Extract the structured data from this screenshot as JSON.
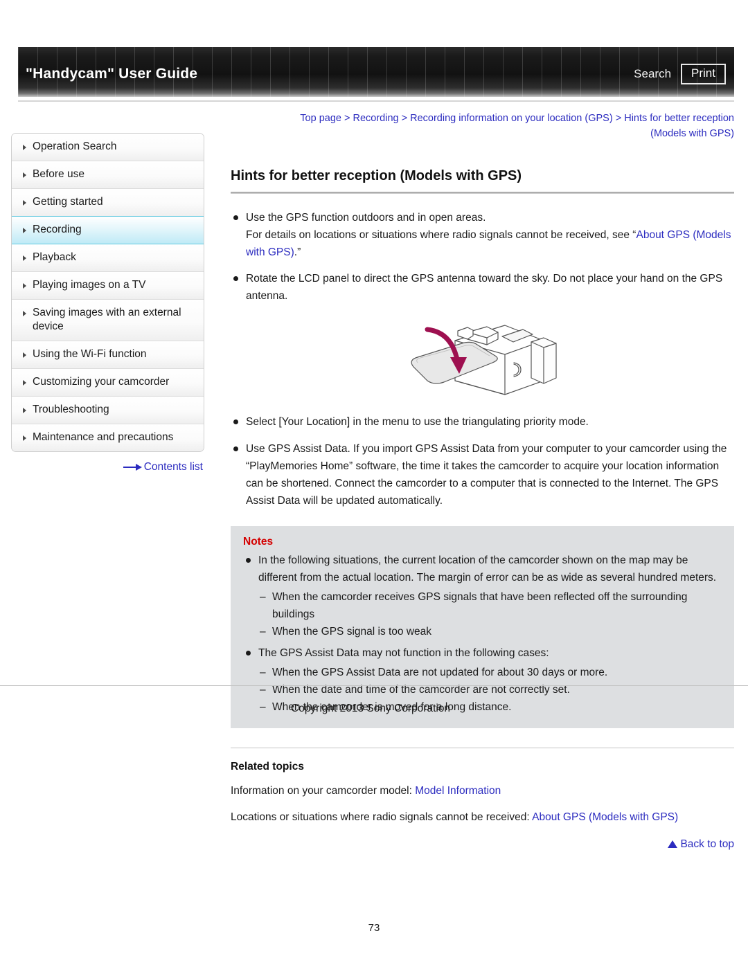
{
  "header": {
    "title": "\"Handycam\" User Guide",
    "search_label": "Search",
    "print_label": "Print"
  },
  "sidebar": {
    "items": [
      {
        "label": "Operation Search",
        "active": false
      },
      {
        "label": "Before use",
        "active": false
      },
      {
        "label": "Getting started",
        "active": false
      },
      {
        "label": "Recording",
        "active": true
      },
      {
        "label": "Playback",
        "active": false
      },
      {
        "label": "Playing images on a TV",
        "active": false
      },
      {
        "label": "Saving images with an external device",
        "active": false
      },
      {
        "label": "Using the Wi-Fi function",
        "active": false
      },
      {
        "label": "Customizing your camcorder",
        "active": false
      },
      {
        "label": "Troubleshooting",
        "active": false
      },
      {
        "label": "Maintenance and precautions",
        "active": false
      }
    ],
    "contents_list_label": "Contents list"
  },
  "breadcrumb": {
    "line1_part1": "Top page",
    "sep": " > ",
    "line1_part2": "Recording",
    "line1_part3": "Recording information on your location (GPS)",
    "line1_part4": "Hints for better reception",
    "line2": "(Models with GPS)"
  },
  "main": {
    "page_title": "Hints for better reception (Models with GPS)",
    "bullet1_line1": "Use the GPS function outdoors and in open areas.",
    "bullet1_line2_pre": "For details on locations or situations where radio signals cannot be received, see “",
    "bullet1_link": "About GPS (Models with GPS)",
    "bullet1_line2_post": ".”",
    "bullet2": "Rotate the LCD panel to direct the GPS antenna toward the sky. Do not place your hand on the GPS antenna.",
    "bullet3": "Select [Your Location] in the menu to use the triangulating priority mode.",
    "bullet4": "Use GPS Assist Data. If you import GPS Assist Data from your computer to your camcorder using the “PlayMemories Home” software, the time it takes the camcorder to acquire your location information can be shortened. Connect the camcorder to a computer that is connected to the Internet. The GPS Assist Data will be updated automatically."
  },
  "notes": {
    "title": "Notes",
    "bullet1": "In the following situations, the current location of the camcorder shown on the map may be different from the actual location. The margin of error can be as wide as several hundred meters.",
    "bullet1_subs": [
      "When the camcorder receives GPS signals that have been reflected off the surrounding buildings",
      "When the GPS signal is too weak"
    ],
    "bullet2": "The GPS Assist Data may not function in the following cases:",
    "bullet2_subs": [
      "When the GPS Assist Data are not updated for about 30 days or more.",
      "When the date and time of the camcorder are not correctly set.",
      "When the camcorder is moved for a long distance."
    ]
  },
  "related": {
    "title": "Related topics",
    "line1_text": "Information on your camcorder model: ",
    "line1_link": "Model Information",
    "line2_text": "Locations or situations where radio signals cannot be received: ",
    "line2_link": "About GPS (Models with GPS)",
    "back_to_top": "Back to top"
  },
  "footer": {
    "copyright": "Copyright 2013 Sony Corporation",
    "page_number": "73"
  },
  "colors": {
    "link": "#2b2bbf",
    "notes_heading": "#d40000",
    "notes_bg": "#dddfe1",
    "active_nav": "#bfeaf6",
    "arrow_illustration": "#9e1050"
  }
}
